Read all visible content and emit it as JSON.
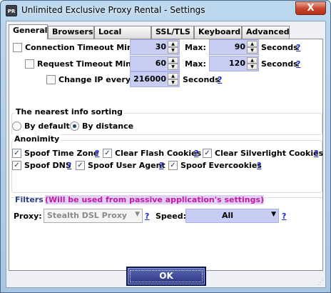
{
  "window": {
    "title": "Unlimited Exclusive Proxy Rental - Settings",
    "icon_text": "PR",
    "close_glyph": "X"
  },
  "tabs": [
    "General",
    "Browsers",
    "Local Server",
    "SSL/TLS",
    "Keyboard",
    "Advanced"
  ],
  "active_tab": "General",
  "timeouts": {
    "connection": {
      "label": "Connection Timeout Min:",
      "min": "30",
      "max_label": "Max:",
      "max": "90",
      "unit": "Seconds",
      "help": "?",
      "checked": false
    },
    "request": {
      "label": "Request Timeout Min:",
      "min": "60",
      "max_label": "Max:",
      "max": "120",
      "unit": "Seconds",
      "help": "?",
      "checked": false
    },
    "change_ip": {
      "label": "Change IP every",
      "value": "216000",
      "unit": "Seconds",
      "help": "?",
      "checked": false
    }
  },
  "sorting": {
    "title": "The nearest info sorting",
    "by_default": "By default",
    "by_distance": "By distance",
    "selected": "By distance"
  },
  "anonimity": {
    "title": "Anonimity",
    "spoof_time_zone": "Spoof Time Zone",
    "clear_flash": "Clear Flash Cookies",
    "clear_silverlight": "Clear Silverlight Cookies",
    "spoof_dns": "Spoof DNS",
    "spoof_user_agent": "Spoof User Agent",
    "spoof_evercookies": "Spoof Evercookies",
    "help": "?"
  },
  "filters": {
    "title": "Filters",
    "note": "(Will be used from passive application's settings)",
    "proxy_label": "Proxy:",
    "proxy_value": "Stealth DSL Proxy",
    "speed_label": "Speed:",
    "speed_value": "All",
    "help": "?"
  },
  "buttons": {
    "ok": "OK"
  },
  "colors": {
    "accent_field": "#c8cdf3",
    "note_bg": "#e1d0f5",
    "note_text": "#c21aa0",
    "help_link": "#1b2bd0"
  }
}
